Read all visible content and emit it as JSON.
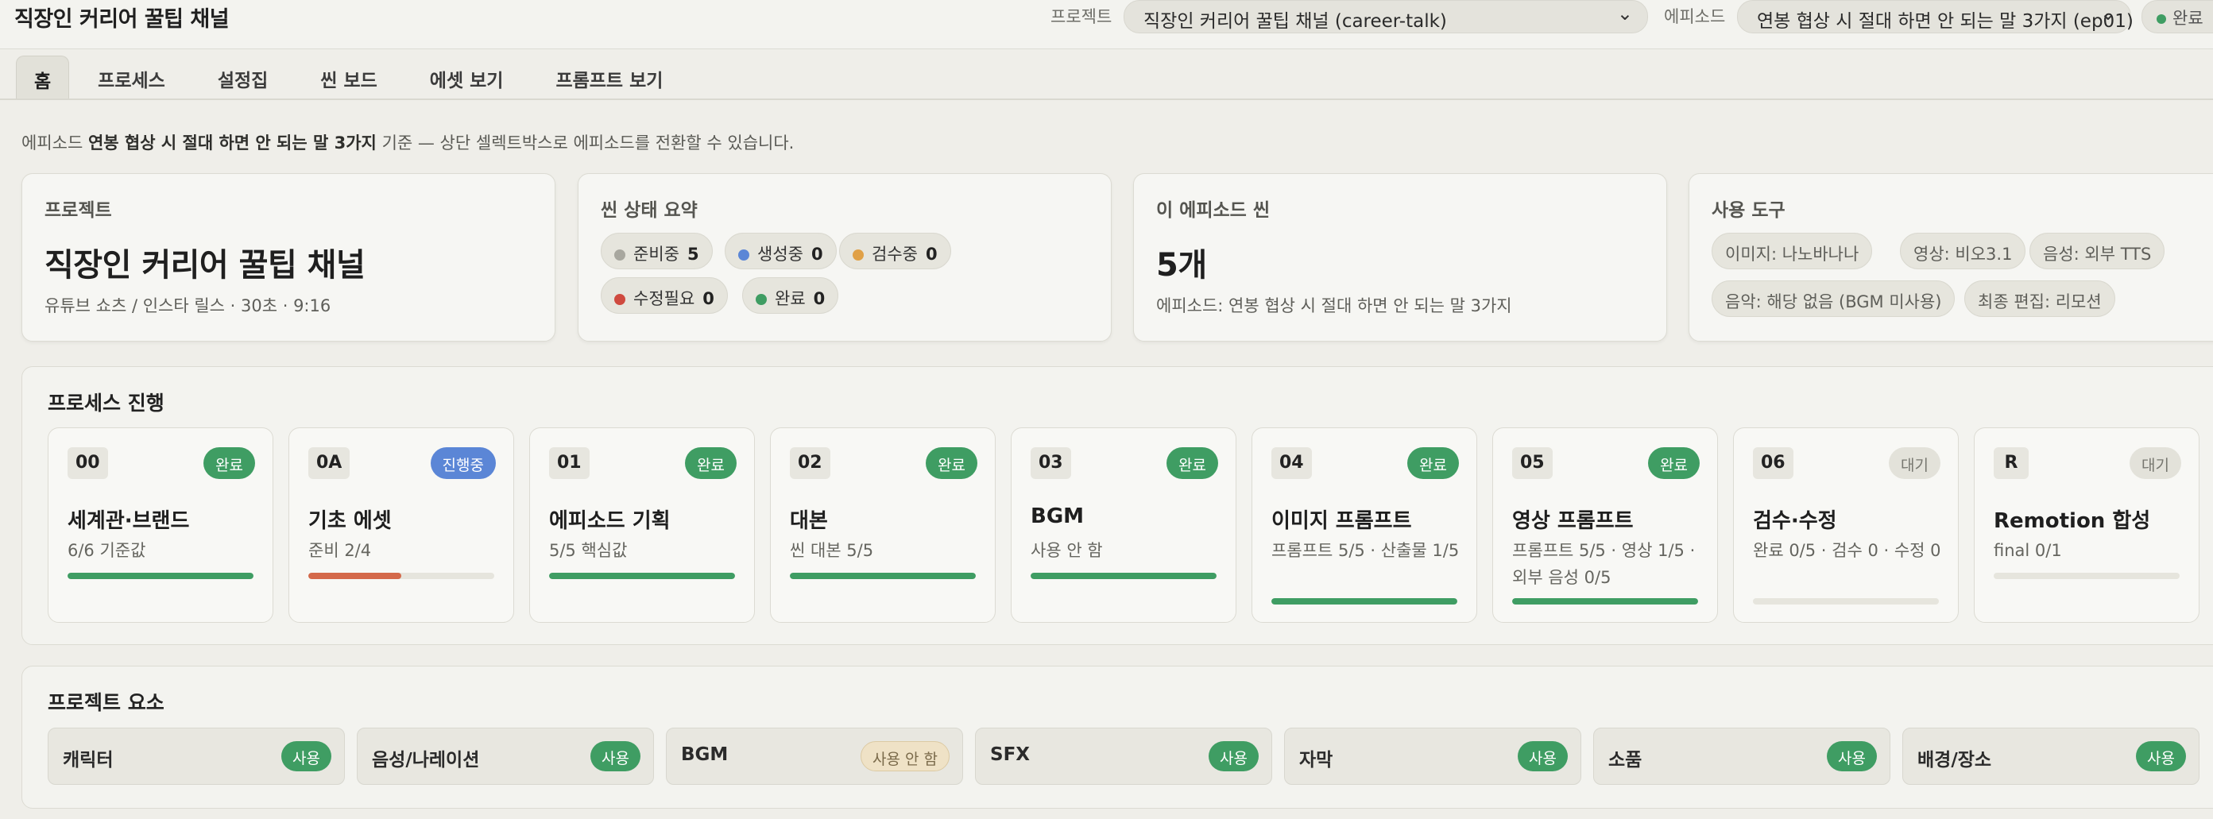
{
  "header": {
    "title": "직장인 커리어 꿀팁 채널",
    "project_label": "프로젝트",
    "project_value": "직장인 커리어 꿀팁 채널 (career-talk)",
    "episode_label": "에피소드",
    "episode_value": "연봉 협상 시 절대 하면 안 되는 말 3가지 (ep01)",
    "status_value": "완료"
  },
  "tabs": [
    "홈",
    "프로세스",
    "설정집",
    "씬 보드",
    "에셋 보기",
    "프롬프트 보기"
  ],
  "notice": {
    "prefix": "에피소드",
    "episode": "연봉 협상 시 절대 하면 안 되는 말 3가지",
    "suffix": "기준 — 상단 셀렉트박스로 에피소드를 전환할 수 있습니다."
  },
  "summary": {
    "project": {
      "label": "프로젝트",
      "name": "직장인 커리어 꿀팁 채널",
      "meta": "유튜브 쇼츠 / 인스타 릴스 · 30초 · 9:16"
    },
    "scene_status": {
      "label": "씬 상태 요약",
      "items": [
        {
          "label": "준비중",
          "count": "5",
          "color": "#a8a79f"
        },
        {
          "label": "생성중",
          "count": "0",
          "color": "#5b86d6"
        },
        {
          "label": "검수중",
          "count": "0",
          "color": "#e0a046"
        },
        {
          "label": "수정필요",
          "count": "0",
          "color": "#cf4a3f"
        },
        {
          "label": "완료",
          "count": "0",
          "color": "#3f9d63"
        }
      ]
    },
    "episode_scenes": {
      "label": "이 에피소드 씬",
      "count": "5개",
      "meta": "에피소드: 연봉 협상 시 절대 하면 안 되는 말 3가지"
    },
    "tools": {
      "label": "사용 도구",
      "items": [
        "이미지: 나노바나나",
        "영상: 비오3.1",
        "음성: 외부 TTS",
        "음악: 해당 없음 (BGM 미사용)",
        "최종 편집: 리모션"
      ]
    }
  },
  "process": {
    "title": "프로세스 진행",
    "steps": [
      {
        "code": "00",
        "badge": "완료",
        "badge_type": "done",
        "title": "세계관·브랜드",
        "desc": "6/6 기준값",
        "progress": 1.0
      },
      {
        "code": "0A",
        "badge": "진행중",
        "badge_type": "progress",
        "title": "기초 에셋",
        "desc": "준비 2/4",
        "progress": 0.5
      },
      {
        "code": "01",
        "badge": "완료",
        "badge_type": "done",
        "title": "에피소드 기획",
        "desc": "5/5 핵심값",
        "progress": 1.0
      },
      {
        "code": "02",
        "badge": "완료",
        "badge_type": "done",
        "title": "대본",
        "desc": "씬 대본 5/5",
        "progress": 1.0
      },
      {
        "code": "03",
        "badge": "완료",
        "badge_type": "done",
        "title": "BGM",
        "desc": "사용 안 함",
        "progress": 1.0
      },
      {
        "code": "04",
        "badge": "완료",
        "badge_type": "done",
        "title": "이미지 프롬프트",
        "desc": "프롬프트 5/5 · 산출물 1/5",
        "progress": 1.0
      },
      {
        "code": "05",
        "badge": "완료",
        "badge_type": "done",
        "title": "영상 프롬프트",
        "desc": "프롬프트 5/5 · 영상 1/5 · 외부 음성 0/5",
        "progress": 1.0
      },
      {
        "code": "06",
        "badge": "대기",
        "badge_type": "wait",
        "title": "검수·수정",
        "desc": "완료 0/5 · 검수 0 · 수정 0",
        "progress": 0
      },
      {
        "code": "R",
        "badge": "대기",
        "badge_type": "wait",
        "title": "Remotion 합성",
        "desc": "final 0/1",
        "progress": 0
      }
    ]
  },
  "elements": {
    "title": "프로젝트 요소",
    "items": [
      {
        "label": "캐릭터",
        "badge": "사용",
        "badge_type": "use"
      },
      {
        "label": "음성/나레이션",
        "badge": "사용",
        "badge_type": "use"
      },
      {
        "label": "BGM",
        "badge": "사용 안 함",
        "badge_type": "nouse"
      },
      {
        "label": "SFX",
        "badge": "사용",
        "badge_type": "use"
      },
      {
        "label": "자막",
        "badge": "사용",
        "badge_type": "use"
      },
      {
        "label": "소품",
        "badge": "사용",
        "badge_type": "use"
      },
      {
        "label": "배경/장소",
        "badge": "사용",
        "badge_type": "use"
      }
    ]
  },
  "colors": {
    "done": "#3f9d63",
    "progress": "#5b86d6",
    "progress_bar": "#d4694a",
    "wait_bg": "#e3e2da",
    "wait_text": "#76766f",
    "nouse_bg": "#efe2c6",
    "nouse_text": "#7a6a4a"
  }
}
